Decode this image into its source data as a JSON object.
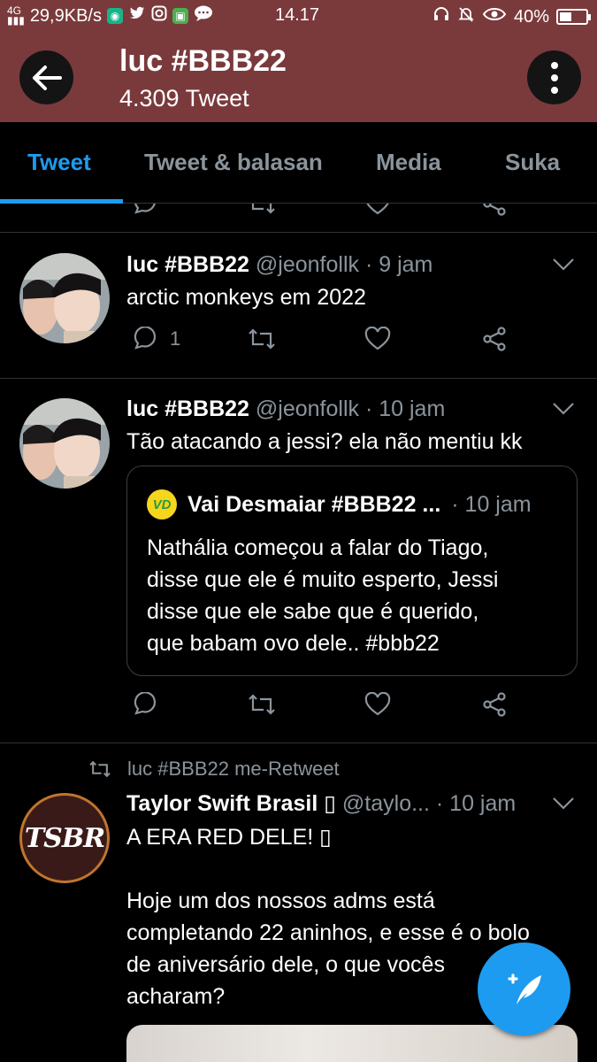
{
  "status_bar": {
    "network": "4G",
    "speed": "29,9KB/s",
    "time": "14.17",
    "battery": "40%",
    "battery_level": 0.4
  },
  "header": {
    "title": "luc #BBB22",
    "tweet_count": "4.309 Tweet"
  },
  "tabs": [
    {
      "label": "Tweet",
      "active": true
    },
    {
      "label": "Tweet & balasan",
      "active": false
    },
    {
      "label": "Media",
      "active": false
    },
    {
      "label": "Suka",
      "active": false
    }
  ],
  "tweets": [
    {
      "name": "luc #BBB22",
      "handle": "@jeonfollk",
      "time": "· 9 jam",
      "text": "arctic monkeys em 2022",
      "reply_count": "1"
    },
    {
      "name": "luc #BBB22",
      "handle": "@jeonfollk",
      "time": "· 10 jam",
      "text": "Tão atacando a jessi? ela não mentiu kk",
      "quote": {
        "name": "Vai Desmaiar #BBB22 ...",
        "time": "· 10 jam",
        "text": "Nathália começou a falar do Tiago,\ndisse que ele é muito esperto, Jessi\ndisse que ele sabe que é querido,\nque babam ovo dele.. #bbb22"
      }
    },
    {
      "retweet_label": "luc #BBB22 me-Retweet",
      "name": "Taylor Swift Brasil ▯",
      "handle": "@taylo...",
      "time": "· 10 jam",
      "avatar_text": "TSBR",
      "text": "A ERA RED DELE! ▯\n\nHoje um dos nossos adms está\ncompletando 22 aninhos, e esse é o bolo\nde aniversário dele, o que vocês\nacharam?"
    }
  ],
  "colors": {
    "header_bg": "#7a3a3c",
    "accent": "#1d9bf0",
    "muted": "#8b949c"
  }
}
